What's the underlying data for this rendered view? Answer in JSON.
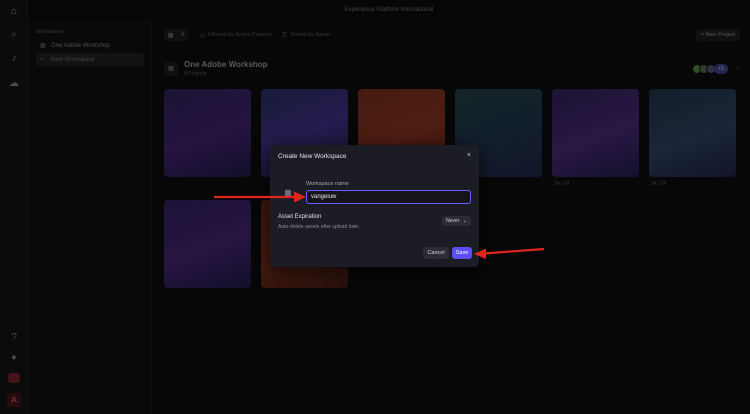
{
  "app": {
    "title": "Experience Platform International"
  },
  "rail": {
    "icons": [
      "home-icon",
      "search-icon",
      "bell-icon",
      "cloud-icon",
      "help-icon",
      "lightbulb-icon",
      "app-icon",
      "adobe-icon"
    ]
  },
  "sidebar": {
    "heading": "Workspaces",
    "items": [
      {
        "label": "One Adobe Workshop",
        "icon": "grid-icon"
      },
      {
        "label": "New Workspace",
        "icon": "plus-icon"
      }
    ]
  },
  "toolbar": {
    "filter_label": "Filtered by",
    "filter_value": "Active Projects",
    "sort_label": "Sorted by",
    "sort_value": "Name",
    "new_project": "+ New Project"
  },
  "workspace": {
    "title": "One Adobe Workshop",
    "subtitle": "8 Projects",
    "member_count": "+1"
  },
  "cards": [
    {
      "meta": ""
    },
    {
      "meta": ""
    },
    {
      "meta": ""
    },
    {
      "meta": ""
    },
    {
      "meta": "24 / 24"
    },
    {
      "meta": "24 / 24"
    },
    {
      "meta": ""
    },
    {
      "meta": ""
    }
  ],
  "dialog": {
    "title": "Create New Workspace",
    "close": "×",
    "field_label": "Workspace name",
    "field_value": "vangeluw",
    "expiration_title": "Asset Expiration",
    "expiration_desc": "Auto-delete assets after upload date.",
    "expiration_value": "Never",
    "cancel": "Cancel",
    "save": "Save"
  },
  "colors": {
    "accent": "#5b4ff2",
    "arrow": "#e0261c",
    "dialog_bg": "#1c1d24"
  }
}
